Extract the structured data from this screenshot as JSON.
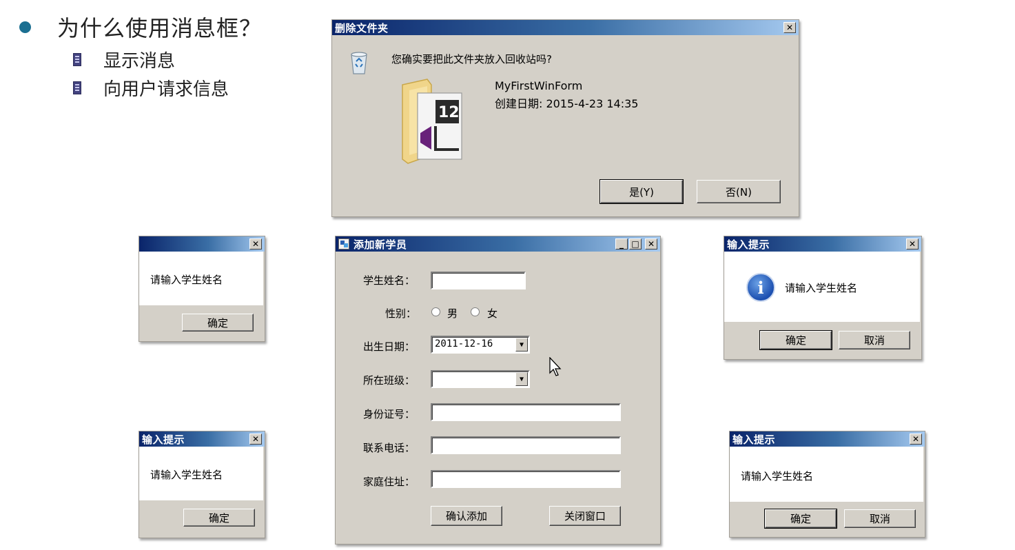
{
  "slide": {
    "heading": "为什么使用消息框？",
    "points": [
      "显示消息",
      "向用户请求信息"
    ]
  },
  "delete_dialog": {
    "title": "删除文件夹",
    "close": "✕",
    "question": "您确实要把此文件夹放入回收站吗?",
    "folder_name": "MyFirstWinForm",
    "created": "创建日期: 2015-4-23 14:35",
    "folder_badge": "12",
    "yes_label": "是(Y)",
    "no_label": "否(N)"
  },
  "msg_plain": {
    "title": "",
    "close": "✕",
    "message": "请输入学生姓名",
    "ok_label": "确定"
  },
  "msg_titled": {
    "title": "输入提示",
    "close": "✕",
    "message": "请输入学生姓名",
    "ok_label": "确定"
  },
  "msg_info": {
    "title": "输入提示",
    "close": "✕",
    "icon_glyph": "i",
    "message": "请输入学生姓名",
    "ok_label": "确定",
    "cancel_label": "取消"
  },
  "msg_okcancel": {
    "title": "输入提示",
    "close": "✕",
    "message": "请输入学生姓名",
    "ok_label": "确定",
    "cancel_label": "取消"
  },
  "student_form": {
    "title": "添加新学员",
    "minimize": "_",
    "maximize": "□",
    "close": "✕",
    "name_label": "学生姓名：",
    "gender_label": "性别：",
    "male": "男",
    "female": "女",
    "birth_label": "出生日期：",
    "birth_value": "2011-12-16",
    "class_label": "所在班级：",
    "class_value": "",
    "id_label": "身份证号：",
    "phone_label": "联系电话：",
    "address_label": "家庭住址：",
    "confirm_label": "确认添加",
    "close_label": "关闭窗口"
  },
  "colors": {
    "title_gradient_start": "#0a246a",
    "title_gradient_end": "#a6caf0",
    "window_face": "#d4d0c8",
    "bullet": "#1b6f91"
  }
}
